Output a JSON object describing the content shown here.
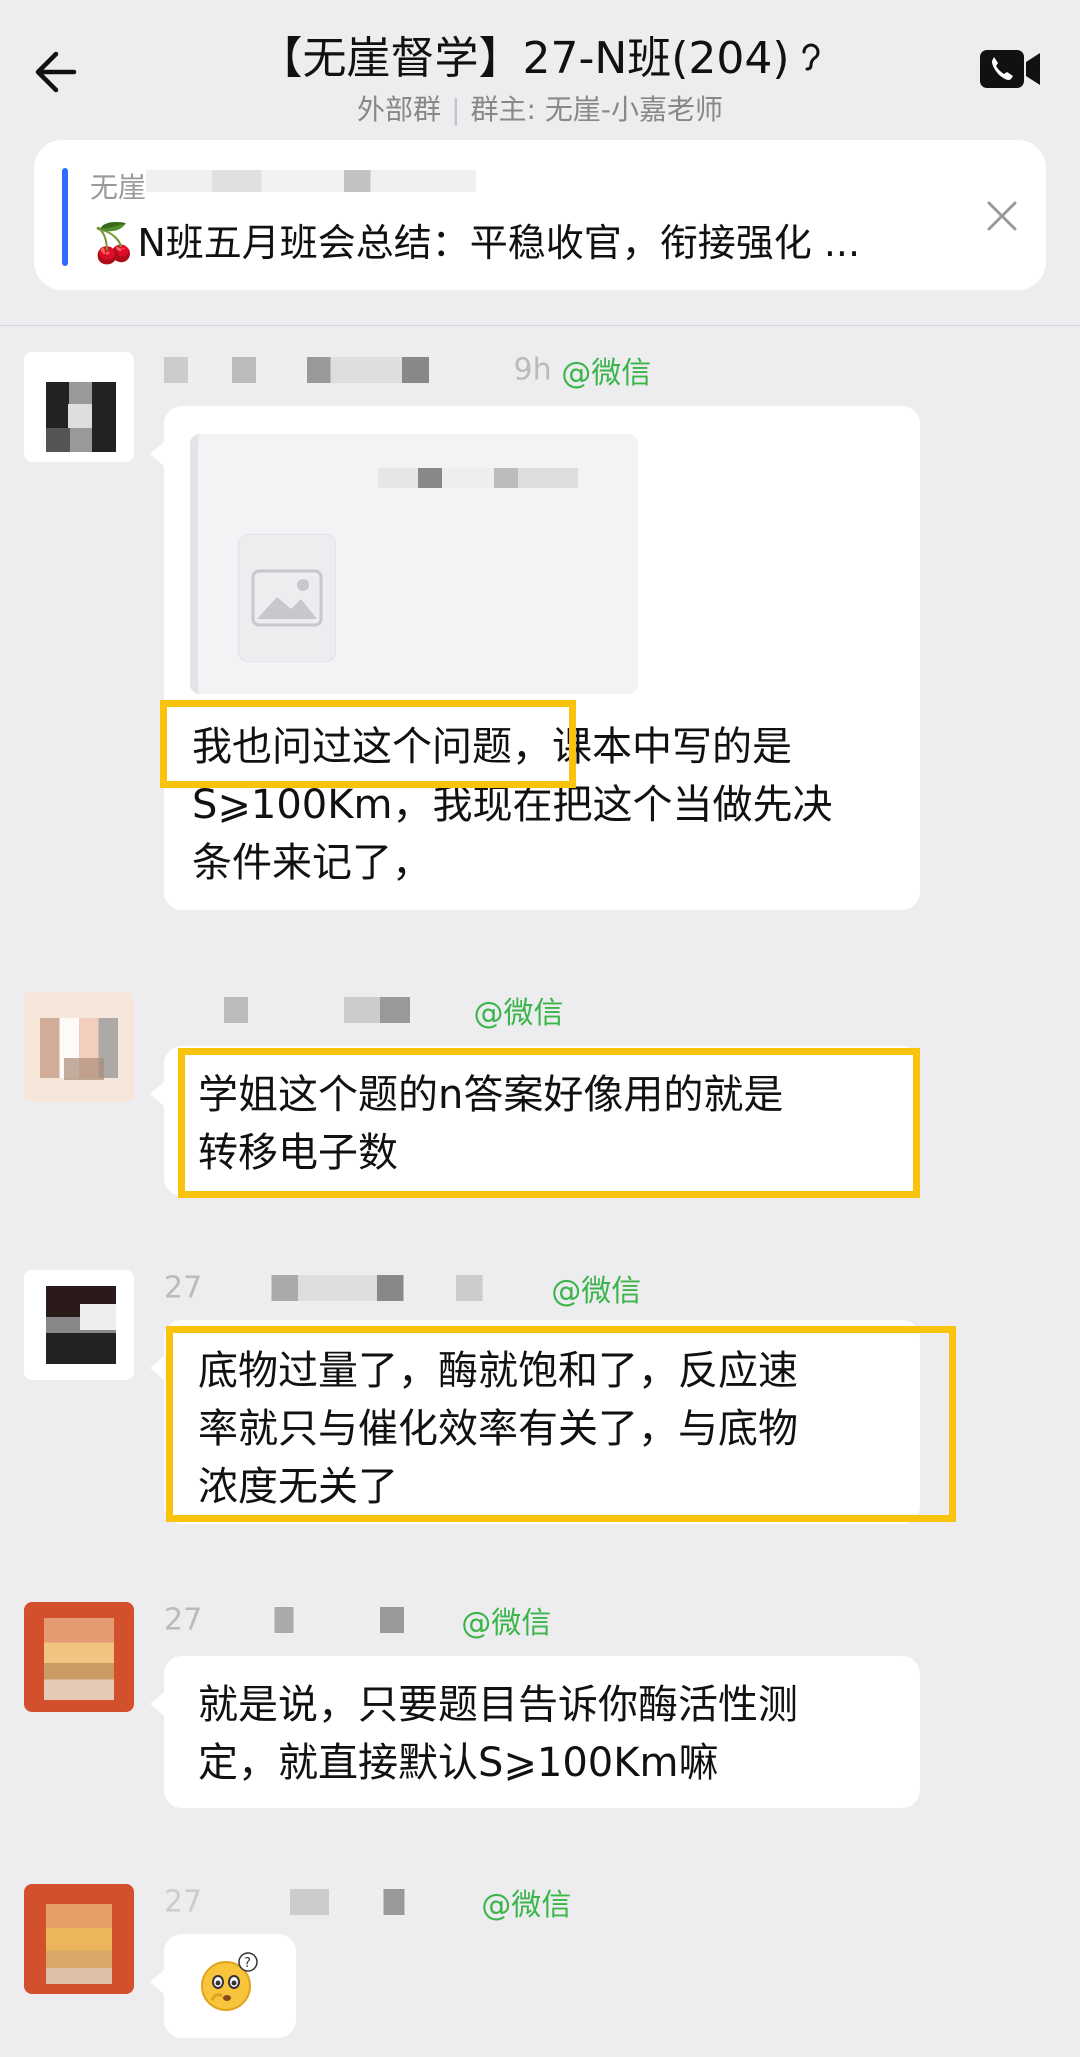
{
  "header": {
    "title": "【无崖督学】27-N班(204)",
    "subtitle_left": "外部群",
    "subtitle_sep": "|",
    "subtitle_right": "群主: 无崖-小嘉老师"
  },
  "notice": {
    "sender": "无崖",
    "text": "🍒N班五月班会总结：平稳收官，衔接强化 ..."
  },
  "messages": [
    {
      "meta_suffix": "9h",
      "source": "@微信",
      "lines": [
        "我也问过这个问题，课本中写的是",
        "S⩾100Km，我现在把这个当做先决",
        "条件来记了，"
      ]
    },
    {
      "source": "@微信",
      "lines": [
        "学姐这个题的n答案好像用的就是",
        "转移电子数"
      ]
    },
    {
      "meta_prefix": "27",
      "source": "@微信",
      "lines": [
        "底物过量了，酶就饱和了，反应速",
        "率就只与催化效率有关了，与底物",
        "浓度无关了"
      ]
    },
    {
      "meta_prefix": "27",
      "source": "@微信",
      "lines": [
        "就是说，只要题目告诉你酶活性测",
        "定，就直接默认S⩾100Km嘛"
      ]
    },
    {
      "meta_prefix": "27",
      "source": "@微信"
    }
  ],
  "colors": {
    "wechat_green": "#3BB54A",
    "highlight": "#F8C20D",
    "notice_bar": "#2F6BFF"
  },
  "icons": [
    "back-arrow-icon",
    "help-ear-icon",
    "video-call-icon",
    "close-icon",
    "image-placeholder-icon",
    "confused-emoji-icon"
  ]
}
